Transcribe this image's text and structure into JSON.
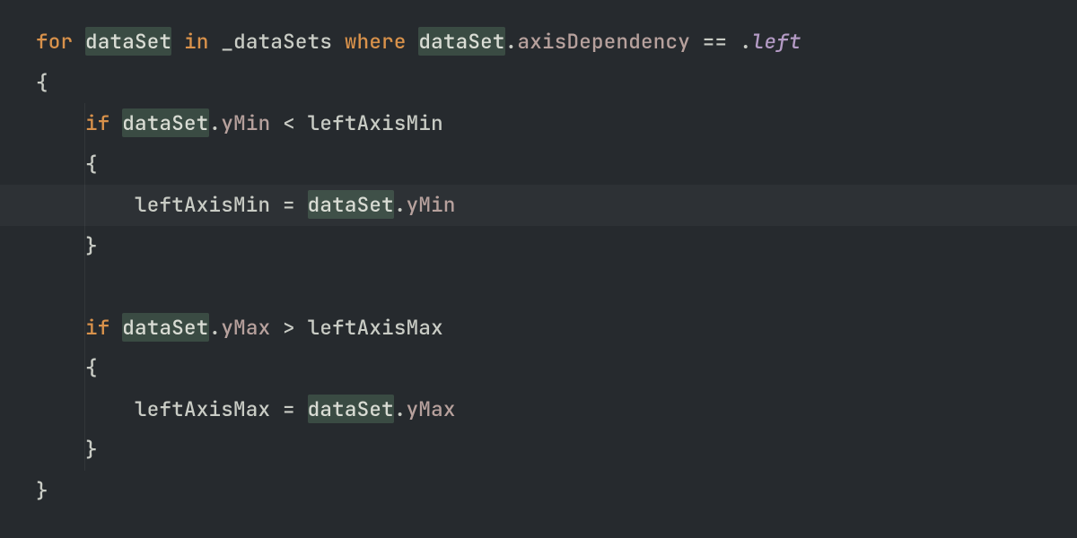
{
  "code": {
    "kw_for": "for",
    "kw_in": "in",
    "kw_where": "where",
    "kw_if": "if",
    "ident_dataSet": "dataSet",
    "ident_dataSets": "_dataSets",
    "ident_leftAxisMin": "leftAxisMin",
    "ident_leftAxisMax": "leftAxisMax",
    "mem_axisDependency": "axisDependency",
    "mem_yMin": "yMin",
    "mem_yMax": "yMax",
    "enum_left": "left",
    "op_eqeq": "==",
    "op_lt": "<",
    "op_gt": ">",
    "op_assign": "=",
    "brace_open": "{",
    "brace_close": "}",
    "dot": "."
  }
}
